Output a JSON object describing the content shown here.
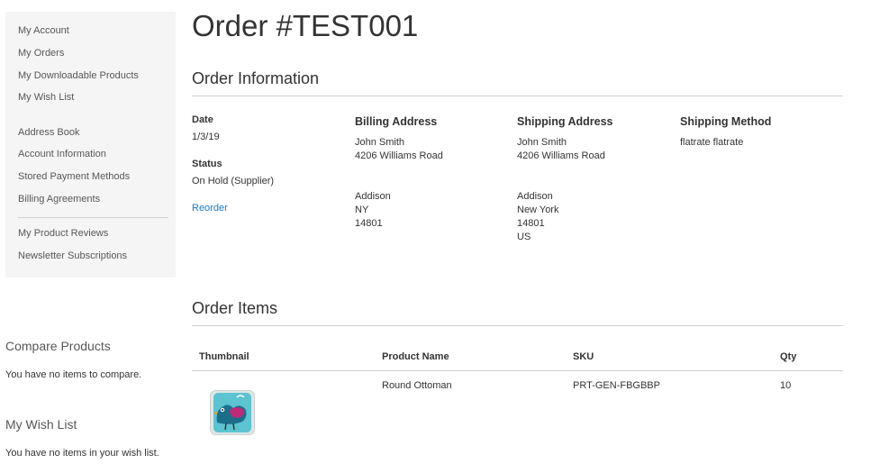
{
  "sidebar": {
    "items": [
      {
        "label": "My Account"
      },
      {
        "label": "My Orders"
      },
      {
        "label": "My Downloadable Products"
      },
      {
        "label": "My Wish List"
      },
      {
        "label": "Address Book"
      },
      {
        "label": "Account Information"
      },
      {
        "label": "Stored Payment Methods"
      },
      {
        "label": "Billing Agreements"
      },
      {
        "label": "My Product Reviews"
      },
      {
        "label": "Newsletter Subscriptions"
      }
    ]
  },
  "compare": {
    "title": "Compare Products",
    "empty": "You have no items to compare."
  },
  "wishlist": {
    "title": "My Wish List",
    "empty": "You have no items in your wish list."
  },
  "page": {
    "title": "Order #TEST001"
  },
  "order_info": {
    "title": "Order Information",
    "date_label": "Date",
    "date_value": "1/3/19",
    "status_label": "Status",
    "status_value": "On Hold (Supplier)",
    "reorder": "Reorder",
    "billing": {
      "title": "Billing Address",
      "lines": [
        "John Smith",
        "4206 Williams Road",
        "Addison",
        "NY",
        "14801"
      ]
    },
    "shipping": {
      "title": "Shipping Address",
      "lines": [
        "John Smith",
        "4206 Williams Road",
        "Addison",
        "New York",
        "14801",
        "US"
      ]
    },
    "method": {
      "title": "Shipping Method",
      "value": "flatrate flatrate"
    }
  },
  "order_items": {
    "title": "Order Items",
    "columns": [
      "Thumbnail",
      "Product Name",
      "SKU",
      "Qty"
    ],
    "rows": [
      {
        "name": "Round Ottoman",
        "sku": "PRT-GEN-FBGBBP",
        "qty": "10",
        "thumbnail_icon": "bird-ottoman-thumbnail"
      }
    ]
  }
}
